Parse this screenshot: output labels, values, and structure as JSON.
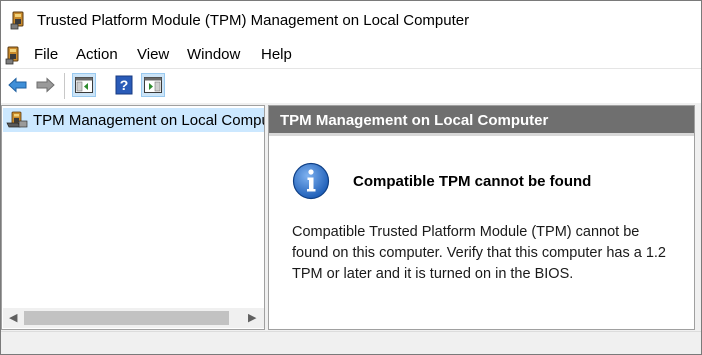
{
  "window": {
    "title": "Trusted Platform Module (TPM) Management on Local Computer"
  },
  "menubar": {
    "items": [
      {
        "label": "File"
      },
      {
        "label": "Action"
      },
      {
        "label": "View"
      },
      {
        "label": "Window"
      },
      {
        "label": "Help"
      }
    ]
  },
  "toolbar": {
    "buttons": [
      {
        "icon": "back-arrow-icon"
      },
      {
        "icon": "forward-arrow-icon"
      },
      {
        "icon": "show-hide-console-tree-icon"
      },
      {
        "icon": "help-icon"
      },
      {
        "icon": "show-hide-action-pane-icon"
      }
    ]
  },
  "tree": {
    "items": [
      {
        "label": "TPM Management on Local Computer",
        "selected": true
      }
    ]
  },
  "detail": {
    "header": "TPM Management on Local Computer",
    "heading": "Compatible TPM cannot be found",
    "body": "Compatible Trusted Platform Module (TPM) cannot be found on this computer. Verify that this computer has a 1.2 TPM or later and it is turned on in the BIOS."
  },
  "colors": {
    "selection": "#cce8ff",
    "header_bg": "#6f6f6f",
    "info_blue": "#1f5fb8"
  }
}
